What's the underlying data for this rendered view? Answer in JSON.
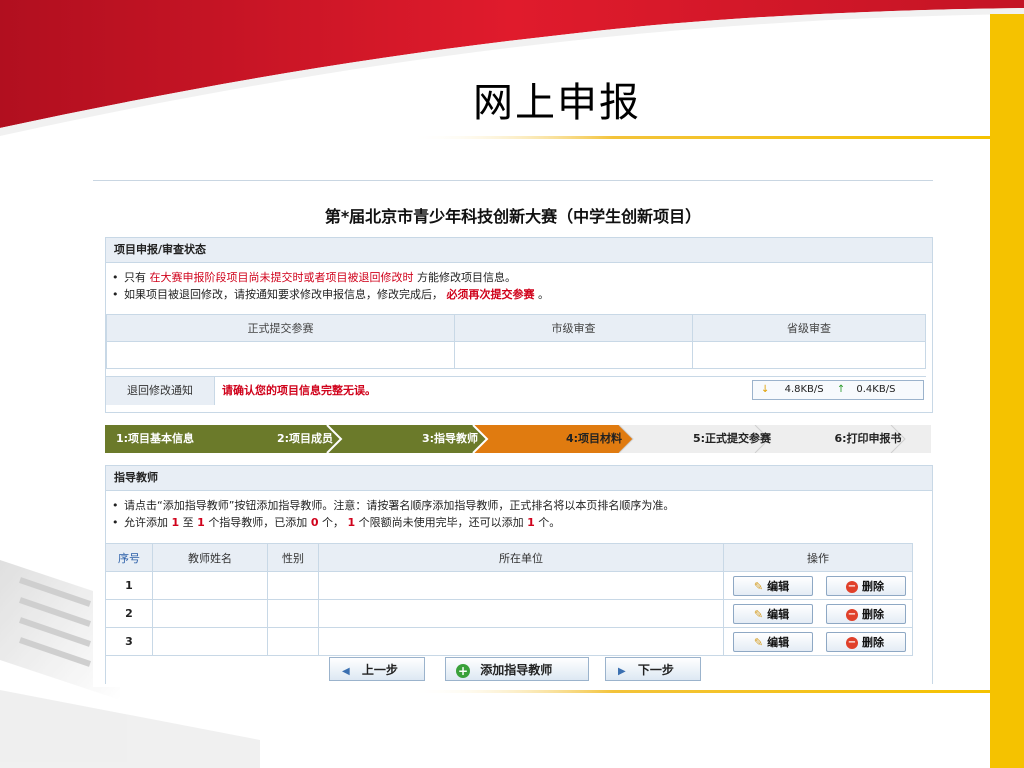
{
  "slide": {
    "title": "网上申报"
  },
  "contest": {
    "title": "第*届北京市青少年科技创新大赛（中学生创新项目）"
  },
  "status_section": {
    "header": "项目申报/审查状态",
    "note1": {
      "prefix": "只有",
      "highlight": "在大赛申报阶段项目尚未提交时或者项目被退回修改时",
      "suffix": "方能修改项目信息。"
    },
    "note2": {
      "prefix": "如果项目被退回修改，请按通知要求修改申报信息，修改完成后，",
      "highlight": "必须再次提交参赛",
      "suffix": "。"
    },
    "columns": [
      "正式提交参赛",
      "市级审查",
      "省级审查"
    ],
    "return_notice_label": "退回修改通知",
    "return_notice_text": "请确认您的项目信息完整无误。",
    "speed": {
      "down": "4.8KB/S",
      "up": "0.4KB/S"
    }
  },
  "steps": [
    "1:项目基本信息",
    "2:项目成员",
    "3:指导教师",
    "4:项目材料",
    "5:正式提交参赛",
    "6:打印申报书"
  ],
  "teacher_section": {
    "header": "指导教师",
    "note1": "请点击“添加指导教师”按钮添加指导教师。注意：请按署名顺序添加指导教师，正式排名将以本页排名顺序为准。",
    "note2": {
      "p1": "允许添加",
      "n1": "1",
      "p2": "至",
      "n2": "1",
      "p3": "个指导教师，已添加",
      "n3": "0",
      "p4": "个，",
      "n4": "1",
      "p5": "个限额尚未使用完毕，还可以添加",
      "n5": "1",
      "p6": "个。"
    },
    "columns": [
      "序号",
      "教师姓名",
      "性别",
      "所在单位",
      "操作"
    ],
    "rows": [
      "1",
      "2",
      "3"
    ],
    "edit_label": "编辑",
    "delete_label": "删除"
  },
  "nav": {
    "prev": "上一步",
    "add": "添加指导教师",
    "next": "下一步"
  },
  "colors": {
    "red_band": "#d7182a",
    "gold_bar": "#f5c200",
    "active_step": "#e07b10",
    "done_step": "#6b7a2a"
  }
}
